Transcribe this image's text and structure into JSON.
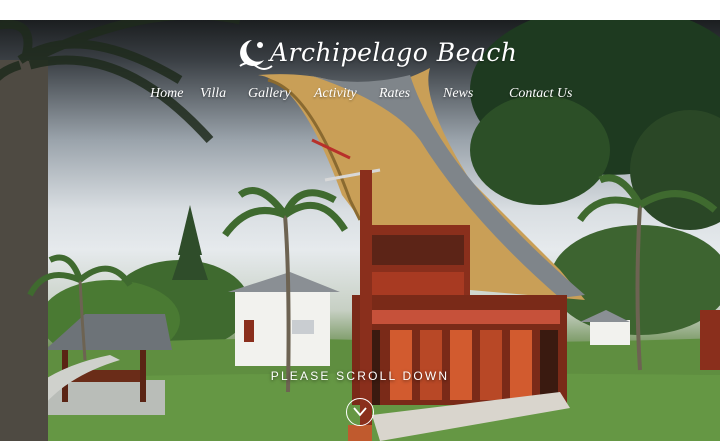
{
  "brand": {
    "name": "Archipelago Beach",
    "logo_icon": "sun-moon-wave-icon"
  },
  "nav": {
    "items": [
      {
        "label": "Home"
      },
      {
        "label": "Villa"
      },
      {
        "label": "Gallery"
      },
      {
        "label": "Activity"
      },
      {
        "label": "Rates"
      },
      {
        "label": "News"
      },
      {
        "label": "Contact Us"
      }
    ]
  },
  "hero": {
    "scroll_label": "PLEASE SCROLL DOWN",
    "scroll_icon": "chevron-down-circle-icon"
  },
  "colors": {
    "text": "#ffffff",
    "roof": "#caa15a",
    "wood": "#8a2f1c",
    "grass": "#5d8a3f"
  }
}
